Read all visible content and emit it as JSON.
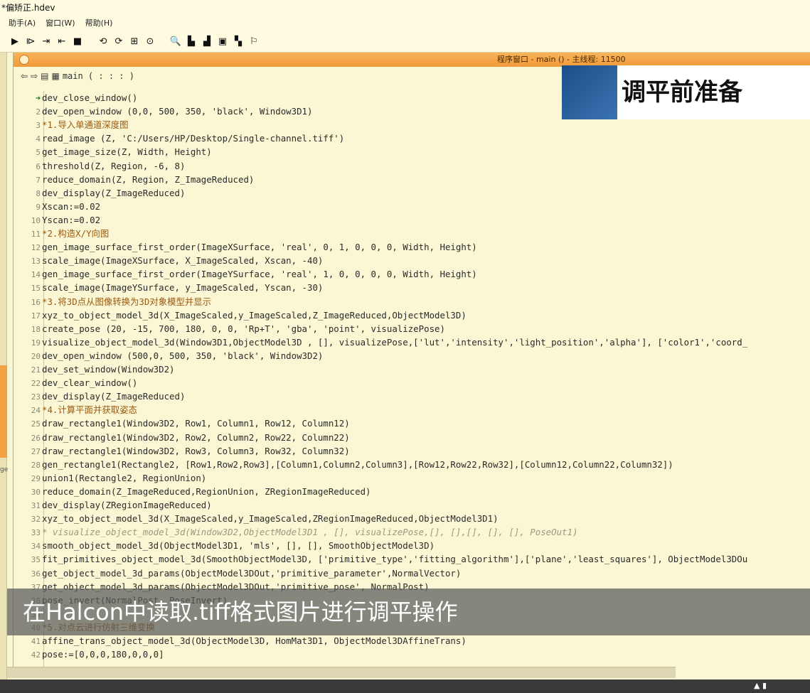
{
  "window": {
    "title": "*偏矫正.hdev"
  },
  "menu": {
    "items": [
      "助手(A)",
      "窗口(W)",
      "帮助(H)"
    ]
  },
  "toolbar": {
    "buttons": [
      {
        "name": "run-icon",
        "glyph": "▶"
      },
      {
        "name": "step-over-icon",
        "glyph": "⧐"
      },
      {
        "name": "step-into-icon",
        "glyph": "⇥"
      },
      {
        "name": "step-back-icon",
        "glyph": "⇤"
      },
      {
        "name": "stop-icon",
        "glyph": "■"
      },
      {
        "name": "reset-icon",
        "glyph": "⟲"
      },
      {
        "name": "reset-all-icon",
        "glyph": "⟳"
      },
      {
        "name": "inspect-icon",
        "glyph": "⊞"
      },
      {
        "name": "timer-icon",
        "glyph": "⊙"
      },
      {
        "name": "zoom-icon",
        "glyph": "🔍"
      },
      {
        "name": "histogram-icon",
        "glyph": "▙"
      },
      {
        "name": "line-profile-icon",
        "glyph": "▟"
      },
      {
        "name": "gray-histogram-icon",
        "glyph": "▣"
      },
      {
        "name": "region-chart-icon",
        "glyph": "▚"
      },
      {
        "name": "feature-icon",
        "glyph": "⚐"
      }
    ]
  },
  "inner_window": {
    "caption": "程序窗口 - main () - 主线程: 11500"
  },
  "editor": {
    "procedure": "main ( : : : )"
  },
  "overlay": {
    "heading": "调平前准备",
    "subtitle": "在Halcon中读取.tiff格式图片进行调平操作"
  },
  "side": {
    "label": "ge"
  },
  "code_lines": [
    {
      "n": "",
      "arrow": true,
      "t": "dev_close_window()",
      "k": ""
    },
    {
      "n": "2",
      "t": "dev_open_window (0,0, 500, 350, 'black', Window3D1)",
      "k": ""
    },
    {
      "n": "3",
      "t": "*1.导入单通道深度图",
      "k": "comment"
    },
    {
      "n": "4",
      "t": "read_image (Z, 'C:/Users/HP/Desktop/Single-channel.tiff')",
      "k": ""
    },
    {
      "n": "5",
      "t": "get_image_size(Z, Width, Height)",
      "k": ""
    },
    {
      "n": "6",
      "t": "threshold(Z, Region, -6, 8)",
      "k": ""
    },
    {
      "n": "7",
      "t": "reduce_domain(Z, Region, Z_ImageReduced)",
      "k": ""
    },
    {
      "n": "8",
      "t": "dev_display(Z_ImageReduced)",
      "k": ""
    },
    {
      "n": "9",
      "t": "Xscan:=0.02",
      "k": ""
    },
    {
      "n": "10",
      "t": "Yscan:=0.02",
      "k": ""
    },
    {
      "n": "11",
      "t": "*2.构造X/Y向图",
      "k": "comment"
    },
    {
      "n": "12",
      "t": "gen_image_surface_first_order(ImageXSurface, 'real', 0, 1, 0, 0, 0, Width, Height)",
      "k": ""
    },
    {
      "n": "13",
      "t": "scale_image(ImageXSurface, X_ImageScaled, Xscan, -40)",
      "k": ""
    },
    {
      "n": "14",
      "t": "gen_image_surface_first_order(ImageYSurface, 'real', 1, 0, 0, 0, 0, Width, Height)",
      "k": ""
    },
    {
      "n": "15",
      "t": "scale_image(ImageYSurface, y_ImageScaled, Yscan, -30)",
      "k": ""
    },
    {
      "n": "16",
      "t": "*3.将3D点从图像转换为3D对象模型并显示",
      "k": "comment"
    },
    {
      "n": "17",
      "t": "xyz_to_object_model_3d(X_ImageScaled,y_ImageScaled,Z_ImageReduced,ObjectModel3D)",
      "k": ""
    },
    {
      "n": "18",
      "t": "create_pose (20, -15, 700, 180, 0, 0, 'Rp+T', 'gba', 'point', visualizePose)",
      "k": ""
    },
    {
      "n": "19",
      "t": "visualize_object_model_3d(Window3D1,ObjectModel3D , [], visualizePose,['lut','intensity','light_position','alpha'], ['color1','coord_",
      "k": ""
    },
    {
      "n": "20",
      "t": "dev_open_window (500,0, 500, 350, 'black', Window3D2)",
      "k": ""
    },
    {
      "n": "21",
      "t": "dev_set_window(Window3D2)",
      "k": ""
    },
    {
      "n": "22",
      "t": "dev_clear_window()",
      "k": ""
    },
    {
      "n": "23",
      "t": "dev_display(Z_ImageReduced)",
      "k": ""
    },
    {
      "n": "24",
      "t": "*4.计算平面并获取姿态",
      "k": "comment"
    },
    {
      "n": "25",
      "t": "draw_rectangle1(Window3D2, Row1, Column1, Row12, Column12)",
      "k": ""
    },
    {
      "n": "26",
      "t": "draw_rectangle1(Window3D2, Row2, Column2, Row22, Column22)",
      "k": ""
    },
    {
      "n": "27",
      "t": "draw_rectangle1(Window3D2, Row3, Column3, Row32, Column32)",
      "k": ""
    },
    {
      "n": "28",
      "t": "gen_rectangle1(Rectangle2, [Row1,Row2,Row3],[Column1,Column2,Column3],[Row12,Row22,Row32],[Column12,Column22,Column32])",
      "k": ""
    },
    {
      "n": "29",
      "t": "union1(Rectangle2, RegionUnion)",
      "k": ""
    },
    {
      "n": "30",
      "t": "reduce_domain(Z_ImageReduced,RegionUnion, ZRegionImageReduced)",
      "k": ""
    },
    {
      "n": "31",
      "t": "dev_display(ZRegionImageReduced)",
      "k": ""
    },
    {
      "n": "32",
      "t": "xyz_to_object_model_3d(X_ImageScaled,y_ImageScaled,ZRegionImageReduced,ObjectModel3D1)",
      "k": ""
    },
    {
      "n": "33",
      "t": "* visualize_object_model_3d(Window3D2,ObjectModel3D1 , [], visualizePose,[], [],[], [], [], PoseOut1)",
      "k": "faded"
    },
    {
      "n": "34",
      "t": "smooth_object_model_3d(ObjectModel3D1, 'mls', [], [], SmoothObjectModel3D)",
      "k": ""
    },
    {
      "n": "35",
      "t": "fit_primitives_object_model_3d(SmoothObjectModel3D, ['primitive_type','fitting_algorithm'],['plane','least_squares'], ObjectModel3DOu",
      "k": ""
    },
    {
      "n": "36",
      "t": "get_object_model_3d_params(ObjectModel3DOut,'primitive_parameter',NormalVector)",
      "k": ""
    },
    {
      "n": "37",
      "t": "get_object_model_3d_params(ObjectModel3DOut,'primitive_pose', NormalPost)",
      "k": ""
    },
    {
      "n": "38",
      "t": "pose_invert(NormalPost, PoseInvert)",
      "k": ""
    },
    {
      "n": "39",
      "t": "",
      "k": ""
    },
    {
      "n": "40",
      "t": "*5.对点云进行仿射三维变换",
      "k": "comment"
    },
    {
      "n": "41",
      "t": "affine_trans_object_model_3d(ObjectModel3D, HomMat3D1, ObjectModel3DAffineTrans)",
      "k": ""
    },
    {
      "n": "42",
      "t": "pose:=[0,0,0,180,0,0,0]",
      "k": ""
    }
  ]
}
